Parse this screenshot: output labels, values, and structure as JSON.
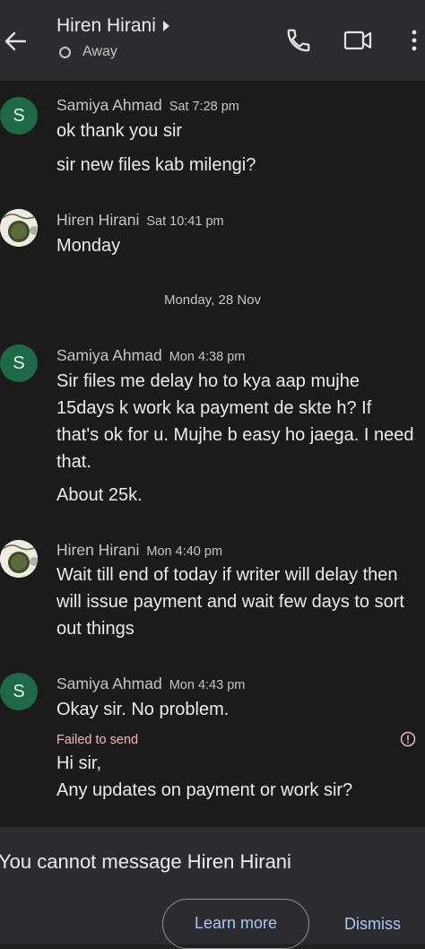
{
  "header": {
    "title": "Hiren Hirani",
    "status": "Away",
    "icons": [
      "back-arrow-icon",
      "chevron-right-icon",
      "status-circle-icon",
      "phone-icon",
      "video-camera-icon",
      "more-vert-icon"
    ]
  },
  "messages": {
    "group1": {
      "avatar": "S",
      "sender": "Samiya Ahmad",
      "time": "Sat 7:28 pm",
      "lines": [
        "ok thank you sir",
        "sir new files kab milengi?"
      ]
    },
    "group2": {
      "sender": "Hiren Hirani",
      "time": "Sat 10:41 pm",
      "lines": [
        "Monday"
      ]
    },
    "date_separator": "Monday, 28 Nov",
    "group3": {
      "avatar": "S",
      "sender": "Samiya Ahmad",
      "time": "Mon 4:38 pm",
      "lines": [
        "Sir files me delay ho to kya aap mujhe 15days k work ka payment de skte h? If that's ok for u. Mujhe b easy ho jaega. I need that.",
        "About 25k."
      ]
    },
    "group4": {
      "sender": "Hiren Hirani",
      "time": "Mon 4:40 pm",
      "lines": [
        "Wait till end of today if writer will delay then will issue payment and wait few days to sort out things"
      ]
    },
    "group5": {
      "avatar": "S",
      "sender": "Samiya Ahmad",
      "time": "Mon 4:43 pm",
      "lines": [
        "Okay sir. No problem."
      ],
      "failed_label": "Failed to send",
      "failed_lines": [
        "Hi sir,",
        "Any updates on payment or work sir?"
      ]
    }
  },
  "bottom": {
    "notice": "You cannot message Hiren Hirani",
    "learn_more": "Learn more",
    "dismiss": "Dismiss"
  },
  "colors": {
    "background": "#1b1b1b",
    "header": "#2b2c2e",
    "avatar_green": "#1e6a47",
    "link_blue": "#a8c7fa",
    "error": "#f2b8b5"
  }
}
